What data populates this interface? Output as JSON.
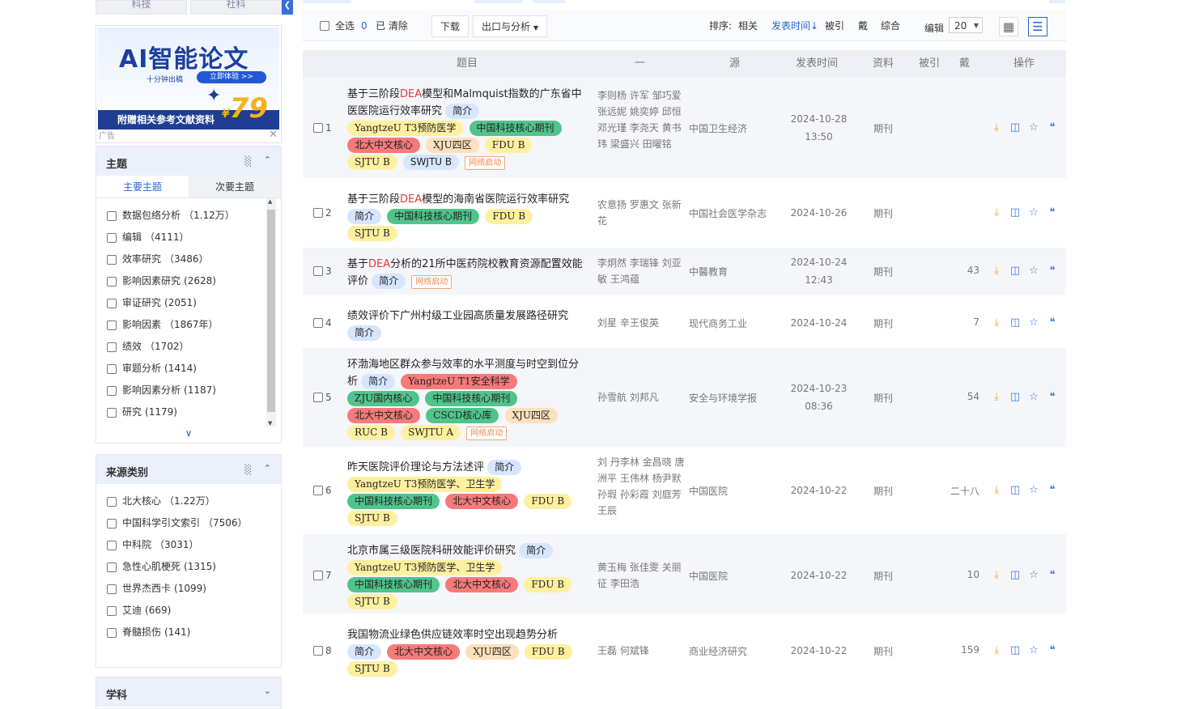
{
  "sidebar": {
    "top_tabs": [
      "科技",
      "社科"
    ],
    "ad": {
      "title": "AI智能论文",
      "subtitle": "十分钟出稿",
      "button": "立即体验 >>",
      "bar_text": "附赠相关参考文献资料",
      "price_symbol": "¥",
      "price": "79",
      "label": "广告"
    },
    "topic": {
      "title": "主题",
      "tabs": [
        "主要主题",
        "次要主题"
      ],
      "items": [
        {
          "label": "数据包络分析",
          "count": "（1.12万）"
        },
        {
          "label": "编辑",
          "count": "（4111）"
        },
        {
          "label": "效率研究",
          "count": "（3486）"
        },
        {
          "label": "影响因素研究",
          "count": "(2628)"
        },
        {
          "label": "审证研究",
          "count": "(2051)"
        },
        {
          "label": "影响因素",
          "count": "（1867年）"
        },
        {
          "label": "绩效",
          "count": "（1702）"
        },
        {
          "label": "审题分析",
          "count": "(1414)"
        },
        {
          "label": "影响因素分析",
          "count": "(1187)"
        },
        {
          "label": "研究",
          "count": "(1179)"
        }
      ]
    },
    "source_type": {
      "title": "来源类别",
      "items": [
        {
          "label": "北大核心",
          "count": "（1.22万）"
        },
        {
          "label": "中国科学引文索引",
          "count": "（7506）"
        },
        {
          "label": "中科院",
          "count": "（3031）"
        },
        {
          "label": "急性心肌梗死",
          "count": "(1315)"
        },
        {
          "label": "世界杰西卡",
          "count": "(1099)"
        },
        {
          "label": "艾迪",
          "count": "(669)"
        },
        {
          "label": "脊髓损伤",
          "count": "(141)"
        }
      ]
    },
    "discipline": {
      "title": "学科"
    }
  },
  "toolbar": {
    "select_all": "全选",
    "selected_count": "0",
    "clear": "已 清除",
    "download": "下载",
    "export": "出口与分析",
    "sort_label": "排序:",
    "sort_relevance": "相关",
    "sort_date": "发表时间",
    "sort_cite": "被引",
    "sort_dl": "戴",
    "sort_all": "综合",
    "page_size_label": "编辑",
    "page_size": "20"
  },
  "table": {
    "headers": [
      "题目",
      "一",
      "源",
      "发表时间",
      "资料",
      "被引",
      "戴",
      "操作"
    ],
    "rows": [
      {
        "no": "1",
        "title_pre": "基于三阶段",
        "title_hl": "DEA",
        "title_post": "模型和Malmquist指数的广东省中医医院运行效率研究",
        "tags": [
          [
            "简介",
            "blue"
          ],
          [
            "YangtzeU T3预防医学",
            "yellow"
          ],
          [
            "中国科技核心期刊",
            "green"
          ],
          [
            "北大中文核心",
            "red"
          ],
          [
            "XJU四区",
            "orange"
          ],
          [
            "FDU B",
            "yellow"
          ],
          [
            "SJTU B",
            "yellow"
          ],
          [
            "SWJTU B",
            "blue"
          ],
          [
            "网络启动",
            "net"
          ]
        ],
        "authors": "李则杨 许军 邹巧爱 张远妮 姚奕婷 邱恒 邓光瑾 李尧天 黄书玮 梁盛兴 田曜铭",
        "source": "中国卫生经济",
        "date": "2024-10-28",
        "time": "13:50",
        "db": "期刊",
        "cite": "",
        "dl": ""
      },
      {
        "no": "2",
        "title_pre": "基于三阶段",
        "title_hl": "DEA",
        "title_post": "模型的海南省医院运行效率研究",
        "tags": [
          [
            "简介",
            "blue"
          ],
          [
            "中国科技核心期刊",
            "green"
          ],
          [
            "FDU B",
            "yellow"
          ],
          [
            "SJTU B",
            "yellow"
          ]
        ],
        "authors": "农意扬 罗惠文 张新花",
        "source": "中国社会医学杂志",
        "date": "2024-10-26",
        "time": "",
        "db": "期刊",
        "cite": "",
        "dl": ""
      },
      {
        "no": "3",
        "title_pre": "基于",
        "title_hl": "DEA",
        "title_post": "分析的21所中医药院校教育资源配置效能评价",
        "tags": [
          [
            "简介",
            "blue"
          ],
          [
            "网络启动",
            "net"
          ]
        ],
        "authors": "李炯然 李瑞锋 刘亚敏 王鸿蕴",
        "source": "中醫教育",
        "date": "2024-10-24",
        "time": "12:43",
        "db": "期刊",
        "cite": "",
        "dl": "43"
      },
      {
        "no": "4",
        "title_pre": "",
        "title_hl": "",
        "title_post": "绩效评价下广州村级工业园高质量发展路径研究",
        "tags": [
          [
            "简介",
            "blue"
          ]
        ],
        "authors": "刘星 辛王俊英",
        "source": "现代商务工业",
        "date": "2024-10-24",
        "time": "",
        "db": "期刊",
        "cite": "",
        "dl": "7"
      },
      {
        "no": "5",
        "title_pre": "",
        "title_hl": "",
        "title_post": "环渤海地区群众参与效率的水平测度与时空到位分析",
        "tags": [
          [
            "简介",
            "blue"
          ],
          [
            "YangtzeU T1安全科学",
            "red"
          ],
          [
            "ZJU国内核心",
            "green"
          ],
          [
            "中国科技核心期刊",
            "green"
          ],
          [
            "北大中文核心",
            "red"
          ],
          [
            "CSCD核心库",
            "green"
          ],
          [
            "XJU四区",
            "orange"
          ],
          [
            "RUC B",
            "yellow"
          ],
          [
            "SWJTU A",
            "yellow"
          ],
          [
            "网络启动",
            "net"
          ]
        ],
        "authors": "孙雪航 刘邦凡",
        "source": "安全与环境学报",
        "date": "2024-10-23",
        "time": "08:36",
        "db": "期刊",
        "cite": "",
        "dl": "54"
      },
      {
        "no": "6",
        "title_pre": "",
        "title_hl": "",
        "title_post": "昨天医院评价理论与方法述评",
        "tags": [
          [
            "简介",
            "blue"
          ],
          [
            "YangtzeU T3预防医学、卫生学",
            "yellow"
          ],
          [
            "中国科技核心期刊",
            "green"
          ],
          [
            "北大中文核心",
            "red"
          ],
          [
            "FDU B",
            "yellow"
          ],
          [
            "SJTU B",
            "yellow"
          ]
        ],
        "authors": "刘 丹李林 金昌晓 唐洲平 王伟林 杨尹默 孙瑕 孙彩霞 刘庭芳 王辰",
        "source": "中国医院",
        "date": "2024-10-22",
        "time": "",
        "db": "期刊",
        "cite": "",
        "dl": "二十八"
      },
      {
        "no": "7",
        "title_pre": "",
        "title_hl": "",
        "title_post": "北京市属三级医院科研效能评价研究",
        "tags": [
          [
            "简介",
            "blue"
          ],
          [
            "YangtzeU T3预防医学、卫生学",
            "yellow"
          ],
          [
            "中国科技核心期刊",
            "green"
          ],
          [
            "北大中文核心",
            "red"
          ],
          [
            "FDU B",
            "yellow"
          ],
          [
            "SJTU B",
            "yellow"
          ]
        ],
        "authors": "黄玉梅 张佳雯 关丽征 李田浩",
        "source": "中国医院",
        "date": "2024-10-22",
        "time": "",
        "db": "期刊",
        "cite": "",
        "dl": "10"
      },
      {
        "no": "8",
        "title_pre": "",
        "title_hl": "",
        "title_post": "我国物流业绿色供应链效率时空出现趋势分析",
        "tags": [
          [
            "简介",
            "blue"
          ],
          [
            "北大中文核心",
            "red"
          ],
          [
            "XJU四区",
            "orange"
          ],
          [
            "FDU B",
            "yellow"
          ],
          [
            "SJTU B",
            "yellow"
          ]
        ],
        "authors": "王磊 何斌锋",
        "source": "商业经济研究",
        "date": "2024-10-22",
        "time": "",
        "db": "期刊",
        "cite": "",
        "dl": "159"
      }
    ]
  },
  "colors": {
    "accent": "#2a63d4",
    "highlight": "#e4393c",
    "download_icon": "#f0a43a"
  }
}
